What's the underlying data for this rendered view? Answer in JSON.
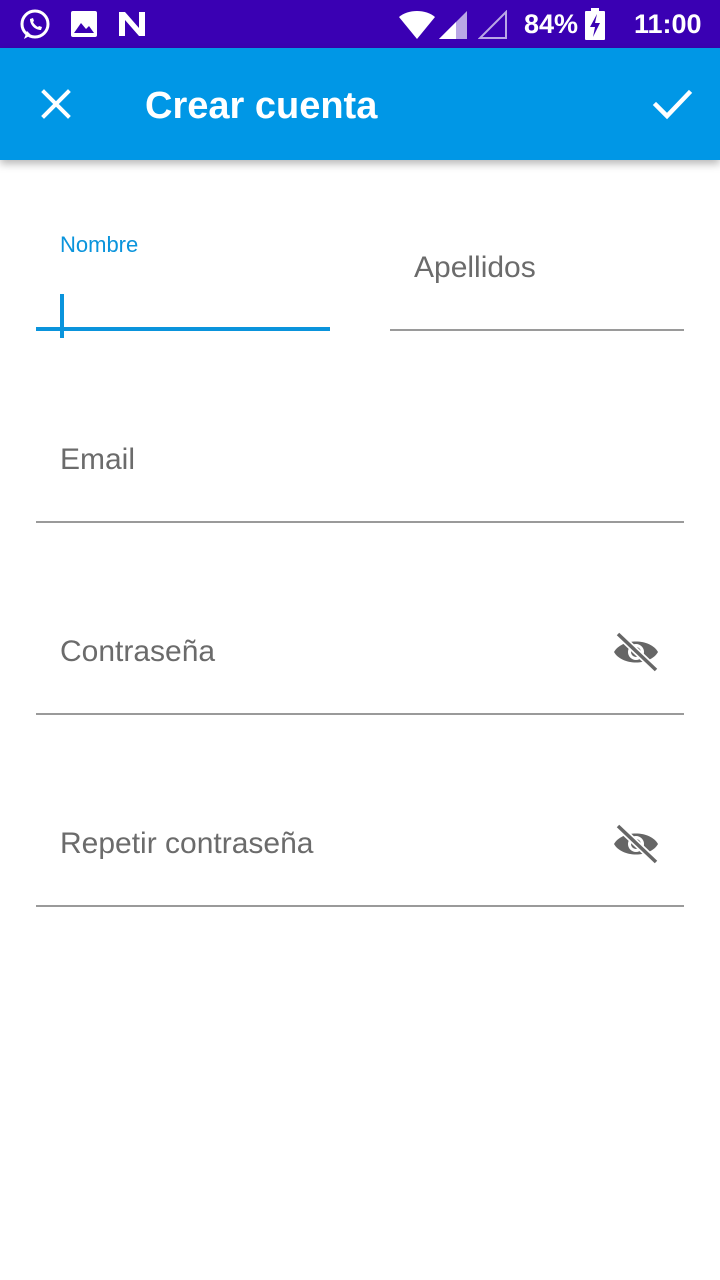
{
  "status_bar": {
    "icons": [
      "whatsapp-icon",
      "gallery-icon",
      "n-app-icon",
      "wifi-icon",
      "signal-icon",
      "signal-empty-icon",
      "battery-charging-icon"
    ],
    "battery": "84%",
    "time": "11:00",
    "background": "#3a00b3"
  },
  "app_bar": {
    "title": "Crear cuenta",
    "close_icon": "close-icon",
    "confirm_icon": "check-icon",
    "background": "#0097e6"
  },
  "form": {
    "first_name": {
      "label": "Nombre",
      "value": ""
    },
    "last_name": {
      "label": "Apellidos",
      "value": ""
    },
    "email": {
      "label": "Email",
      "value": ""
    },
    "password": {
      "label": "Contraseña",
      "value": "",
      "toggle_icon": "eye-off-icon"
    },
    "repeat_password": {
      "label": "Repetir contraseña",
      "value": "",
      "toggle_icon": "eye-off-icon"
    },
    "accent_color": "#0a94dc"
  }
}
